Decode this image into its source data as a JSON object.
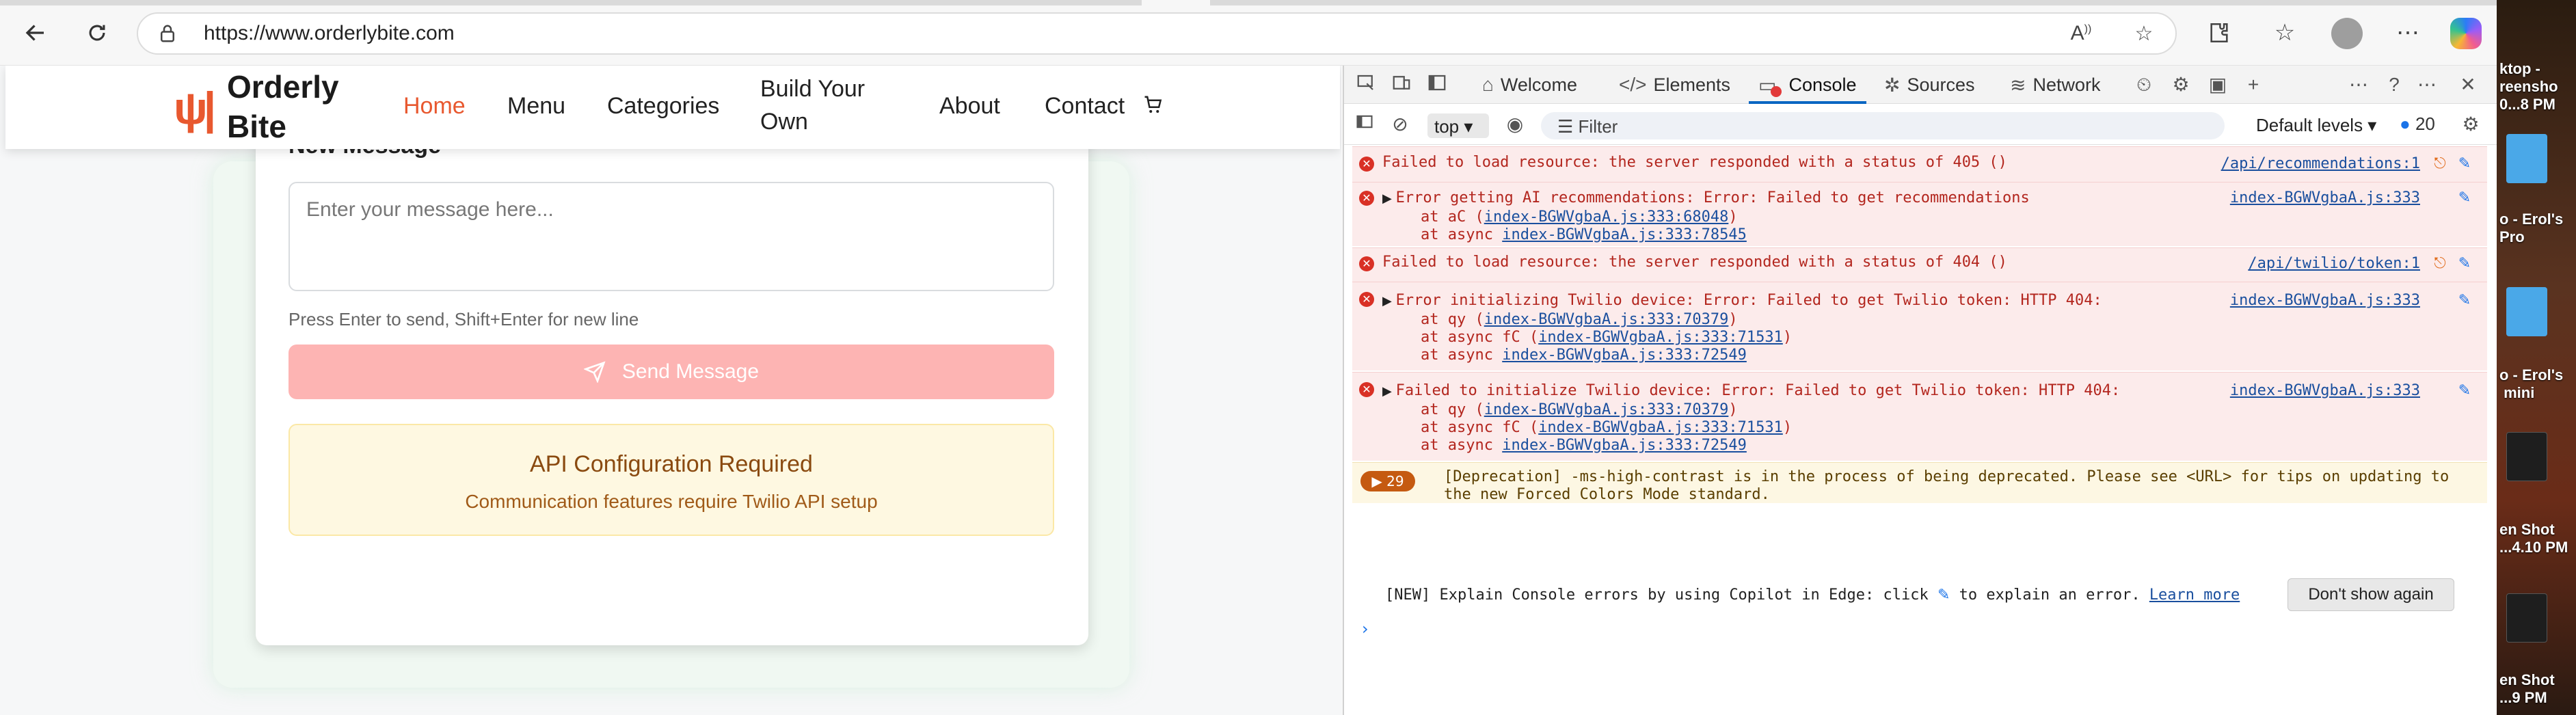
{
  "browser": {
    "url": "https://www.orderlybite.com",
    "back_icon": "back-arrow-icon",
    "refresh_icon": "refresh-icon",
    "lock_icon": "site-info-icon"
  },
  "site": {
    "logo_text": "Orderly Bite",
    "nav": [
      {
        "label": "Home",
        "active": true
      },
      {
        "label": "Menu"
      },
      {
        "label": "Categories"
      },
      {
        "label": "Build Your Own"
      },
      {
        "label": "About"
      },
      {
        "label": "Contact"
      }
    ],
    "accent_color": "#e8582f"
  },
  "message_card": {
    "heading": "New Message",
    "placeholder": "Enter your message here...",
    "hint": "Press Enter to send, Shift+Enter for new line",
    "send_label": "Send Message",
    "api_title": "API Configuration Required",
    "api_subtitle": "Communication features require Twilio API setup"
  },
  "devtools": {
    "tabs": [
      {
        "label": "Welcome",
        "icon": "home-icon"
      },
      {
        "label": "Elements",
        "icon": "code-icon"
      },
      {
        "label": "Console",
        "icon": "console-icon",
        "active": true
      },
      {
        "label": "Sources",
        "icon": "bug-icon"
      },
      {
        "label": "Network",
        "icon": "wifi-icon"
      }
    ],
    "context": "top",
    "filter_placeholder": "Filter",
    "levels": "Default levels",
    "message_count": "20",
    "entries": [
      {
        "text": "Failed to load resource: the server responded with a status of 405 ()",
        "source": "/api/recommendations:1"
      },
      {
        "text": "Error getting AI recommendations: Error: Failed to get recommendations",
        "source": "index-BGWVgbaA.js:333",
        "stack": [
          {
            "prefix": "at aC (",
            "link": "index-BGWVgbaA.js:333:68048",
            "suffix": ")"
          },
          {
            "prefix": "at async ",
            "link": "index-BGWVgbaA.js:333:78545",
            "suffix": ""
          }
        ]
      },
      {
        "text": "Failed to load resource: the server responded with a status of 404 ()",
        "source": "/api/twilio/token:1"
      },
      {
        "text": "Error initializing Twilio device: Error: Failed to get Twilio token: HTTP 404:",
        "source": "index-BGWVgbaA.js:333",
        "stack": [
          {
            "prefix": "at qy (",
            "link": "index-BGWVgbaA.js:333:70379",
            "suffix": ")"
          },
          {
            "prefix": "at async fC (",
            "link": "index-BGWVgbaA.js:333:71531",
            "suffix": ")"
          },
          {
            "prefix": "at async ",
            "link": "index-BGWVgbaA.js:333:72549",
            "suffix": ""
          }
        ]
      },
      {
        "text": "Failed to initialize Twilio device: Error: Failed to get Twilio token: HTTP 404:",
        "source": "index-BGWVgbaA.js:333",
        "stack": [
          {
            "prefix": "at qy (",
            "link": "index-BGWVgbaA.js:333:70379",
            "suffix": ")"
          },
          {
            "prefix": "at async fC (",
            "link": "index-BGWVgbaA.js:333:71531",
            "suffix": ")"
          },
          {
            "prefix": "at async ",
            "link": "index-BGWVgbaA.js:333:72549",
            "suffix": ""
          }
        ]
      }
    ],
    "deprecation": {
      "count": "29",
      "line1": "[Deprecation] -ms-high-contrast is in the process of being deprecated. Please see <URL> for tips on updating to",
      "line2": "the new Forced Colors Mode standard."
    },
    "copilot_banner": {
      "prefix": "[NEW] Explain Console errors by using Copilot in Edge: click",
      "suffix": "to explain an error.",
      "link": "Learn more",
      "dismiss": "Don't show again"
    }
  },
  "desktop": {
    "labels": [
      "ktop -\nreensho\n0...8 PM",
      "o - Erol's\nPro",
      "o - Erol's\n mini",
      "en Shot\n...4.10 PM",
      "en Shot\n...9 PM"
    ]
  }
}
